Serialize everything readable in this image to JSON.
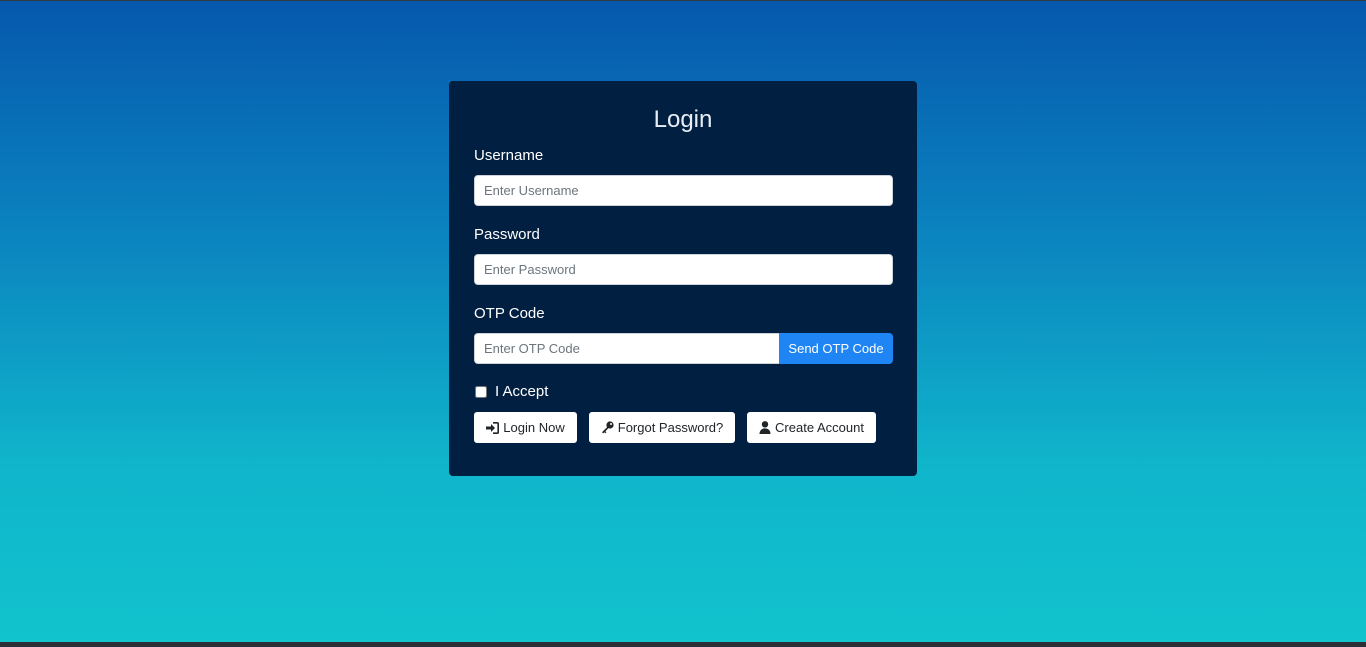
{
  "login": {
    "title": "Login",
    "username": {
      "label": "Username",
      "placeholder": "Enter Username",
      "value": ""
    },
    "password": {
      "label": "Password",
      "placeholder": "Enter Password",
      "value": ""
    },
    "otp": {
      "label": "OTP Code",
      "placeholder": "Enter OTP Code",
      "value": "",
      "send_label": "Send OTP Code"
    },
    "accept": {
      "label": "I Accept",
      "checked": false
    },
    "buttons": {
      "login_label": "Login Now",
      "forgot_label": "Forgot Password?",
      "create_label": "Create Account"
    },
    "icons": {
      "login": "sign-in-icon",
      "forgot": "key-icon",
      "create": "user-icon"
    }
  },
  "colors": {
    "card_background": "#011f41",
    "accent": "#1f85f5",
    "background_top": "#0658ad",
    "background_bottom": "#11c4cd"
  }
}
